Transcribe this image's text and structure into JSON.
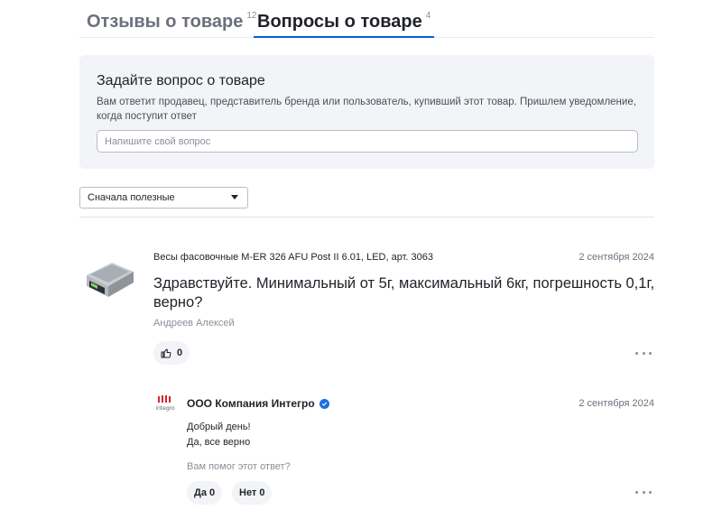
{
  "tabs": [
    {
      "label": "Отзывы о товаре",
      "count": "12",
      "active": false
    },
    {
      "label": "Вопросы о товаре",
      "count": "4",
      "active": true
    }
  ],
  "ask": {
    "title": "Задайте вопрос о товаре",
    "description": "Вам ответит продавец, представитель бренда или пользователь, купивший этот товар. Пришлем уведомление, когда поступит ответ",
    "placeholder": "Напишите свой вопрос",
    "value": ""
  },
  "sort": {
    "selected": "Сначала полезные",
    "icon": "chevron-down-icon"
  },
  "question": {
    "product": "Весы фасовочные M-ER 326 AFU Post II 6.01, LED, арт. 3063",
    "date": "2 сентября 2024",
    "text": "Здравствуйте. Минимальный от 5г, максимальный 6кг, погрешность 0,1г, верно?",
    "author": "Андреев Алексей",
    "likes": "0",
    "icons": {
      "like": "thumbs-up-icon",
      "more": "more-dots-icon",
      "product": "product-thumbnail"
    }
  },
  "answer": {
    "seller": "ООО Компания Интегро",
    "logo_text": "integro",
    "date": "2 сентября 2024",
    "lines": [
      "Добрый день!",
      "Да, все верно"
    ],
    "helpful_prompt": "Вам помог этот ответ?",
    "yes_label": "Да 0",
    "no_label": "Нет 0",
    "icons": {
      "verified": "verified-check-icon",
      "logo": "integro-logo",
      "more": "more-dots-icon"
    }
  },
  "colors": {
    "accent": "#0b5fd6",
    "verified": "#1a6fe3",
    "panel": "#f3f4f7",
    "muted": "#8b8f99"
  }
}
